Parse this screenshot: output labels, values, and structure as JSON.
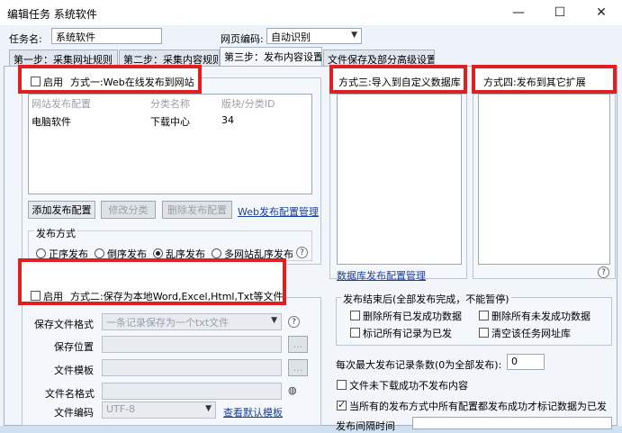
{
  "window": {
    "title": "编辑任务 系统软件",
    "minimize": "—",
    "maximize": "☐",
    "close": "✕"
  },
  "task": {
    "name_label": "任务名:",
    "name_value": "系统软件",
    "encoding_label": "网页编码:",
    "encoding_value": "自动识别"
  },
  "tabs": [
    {
      "label": "第一步：采集网址规则"
    },
    {
      "label": "第二步：采集内容规则"
    },
    {
      "label": "第三步：发布内容设置"
    },
    {
      "label": "文件保存及部分高级设置"
    }
  ],
  "method1": {
    "enable_label": "启用",
    "title": "方式一:Web在线发布到网站",
    "table": {
      "headers": [
        "网站发布配置",
        "分类名称",
        "版块/分类ID"
      ],
      "rows": [
        [
          "电脑软件",
          "下载中心",
          "34"
        ]
      ]
    },
    "buttons": {
      "add": "添加发布配置",
      "edit": "修改分类",
      "delete": "删除发布配置"
    },
    "manage_link": "Web发布配置管理",
    "mode_label": "发布方式",
    "modes": [
      "正序发布",
      "倒序发布",
      "乱序发布",
      "多网站乱序发布"
    ],
    "selected_mode": 2
  },
  "method2": {
    "enable_label": "启用",
    "title": "方式二:保存为本地Word,Excel,Html,Txt等文件",
    "format_label": "保存文件格式",
    "format_value": "一条记录保存为一个txt文件",
    "location_label": "保存位置",
    "template_label": "文件模板",
    "filename_label": "文件名格式",
    "encoding_label": "文件编码",
    "encoding_value": "UTF-8",
    "default_template_link": "查看默认模板",
    "browse": "..."
  },
  "method3": {
    "title": "方式三:导入到自定义数据库",
    "manage_link": "数据库发布配置管理"
  },
  "method4": {
    "title": "方式四:发布到其它扩展"
  },
  "after_publish": {
    "title": "发布结束后(全部发布完成，不能暂停)",
    "options": [
      "删除所有已发成功数据",
      "删除所有未发成功数据",
      "标记所有记录为已发",
      "清空该任务网址库"
    ],
    "max_label": "每次最大发布记录条数(0为全部发布):",
    "max_value": "0",
    "skip_unsuccessful": "文件未下载成功不发布内容",
    "mark_when_all_success": "当所有的发布方式中所有配置都发布成功才标记数据为已发",
    "interval_label": "发布间隔时间"
  },
  "icons": {
    "help": "help-icon",
    "dropdown": "chevron-down-icon"
  }
}
